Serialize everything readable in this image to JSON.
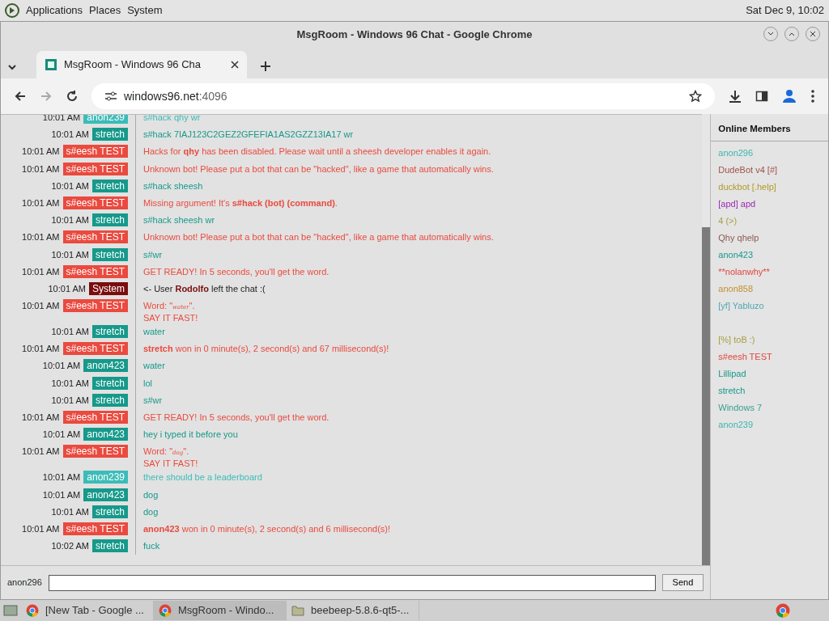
{
  "desktop_bar": {
    "menus": [
      "Applications",
      "Places",
      "System"
    ],
    "clock": "Sat Dec 9, 10:02"
  },
  "window": {
    "title": "MsgRoom - Windows 96 Chat - Google Chrome"
  },
  "tabs": [
    {
      "label": "MsgRoom - Windows 96 Cha",
      "selected": true
    }
  ],
  "address_bar": {
    "host": "windows96.net",
    "port": ":4096"
  },
  "messages": [
    {
      "time": "10:01 AM",
      "user": "anon239",
      "color": "#3bbcb8",
      "kind": "user",
      "lines": [
        "s#hack qhy wr"
      ]
    },
    {
      "time": "10:01 AM",
      "user": "stretch",
      "color": "#16998a",
      "kind": "user",
      "lines": [
        "s#hack 7IAJ123C2GEZ2GFEFIA1AS2GZZ13IA17 wr"
      ]
    },
    {
      "time": "10:01 AM",
      "user": "s#eesh TEST",
      "color": "#ea4a3f",
      "kind": "user",
      "lines": [
        "Hacks for **qhy** has been disabled. Please wait until a sheesh developer enables it again."
      ]
    },
    {
      "time": "10:01 AM",
      "user": "s#eesh TEST",
      "color": "#ea4a3f",
      "kind": "user",
      "lines": [
        "Unknown bot! Please put a bot that can be \"hacked\", like a game that automatically wins."
      ]
    },
    {
      "time": "10:01 AM",
      "user": "stretch",
      "color": "#16998a",
      "kind": "user",
      "lines": [
        "s#hack sheesh"
      ]
    },
    {
      "time": "10:01 AM",
      "user": "s#eesh TEST",
      "color": "#ea4a3f",
      "kind": "user",
      "lines": [
        "Missing argument! It's **s#hack (bot) (command)**."
      ]
    },
    {
      "time": "10:01 AM",
      "user": "stretch",
      "color": "#16998a",
      "kind": "user",
      "lines": [
        "s#hack sheesh wr"
      ]
    },
    {
      "time": "10:01 AM",
      "user": "s#eesh TEST",
      "color": "#ea4a3f",
      "kind": "user",
      "lines": [
        "Unknown bot! Please put a bot that can be \"hacked\", like a game that automatically wins."
      ]
    },
    {
      "time": "10:01 AM",
      "user": "stretch",
      "color": "#16998a",
      "kind": "user",
      "lines": [
        "s#wr"
      ]
    },
    {
      "time": "10:01 AM",
      "user": "s#eesh TEST",
      "color": "#ea4a3f",
      "kind": "user",
      "lines": [
        "GET READY! In 5 seconds, you'll get the word."
      ]
    },
    {
      "time": "10:01 AM",
      "user": "System",
      "color": "#7a0d0d",
      "kind": "system",
      "lines": [
        "<- User **Rodolfo** left the chat :("
      ]
    },
    {
      "time": "10:01 AM",
      "user": "s#eesh TEST",
      "color": "#ea4a3f",
      "kind": "user",
      "word": [
        "Word: \"",
        "water",
        "\"."
      ],
      "lines": [
        "SAY IT FAST!"
      ]
    },
    {
      "time": "10:01 AM",
      "user": "stretch",
      "color": "#16998a",
      "kind": "user",
      "lines": [
        "water"
      ]
    },
    {
      "time": "10:01 AM",
      "user": "s#eesh TEST",
      "color": "#ea4a3f",
      "kind": "user",
      "lines": [
        "**stretch** won in 0 minute(s), 2 second(s) and 67 millisecond(s)!"
      ]
    },
    {
      "time": "10:01 AM",
      "user": "anon423",
      "color": "#16998a",
      "kind": "user",
      "lines": [
        "water"
      ]
    },
    {
      "time": "10:01 AM",
      "user": "stretch",
      "color": "#16998a",
      "kind": "user",
      "lines": [
        "lol"
      ]
    },
    {
      "time": "10:01 AM",
      "user": "stretch",
      "color": "#16998a",
      "kind": "user",
      "lines": [
        "s#wr"
      ]
    },
    {
      "time": "10:01 AM",
      "user": "s#eesh TEST",
      "color": "#ea4a3f",
      "kind": "user",
      "lines": [
        "GET READY! In 5 seconds, you'll get the word."
      ]
    },
    {
      "time": "10:01 AM",
      "user": "anon423",
      "color": "#16998a",
      "kind": "user",
      "lines": [
        "hey i typed it before you"
      ]
    },
    {
      "time": "10:01 AM",
      "user": "s#eesh TEST",
      "color": "#ea4a3f",
      "kind": "user",
      "word": [
        "Word: \"",
        "dog",
        "\"."
      ],
      "lines": [
        "SAY IT FAST!"
      ]
    },
    {
      "time": "10:01 AM",
      "user": "anon239",
      "color": "#3bbcb8",
      "kind": "user",
      "lines": [
        "there should be a leaderboard"
      ]
    },
    {
      "time": "10:01 AM",
      "user": "anon423",
      "color": "#16998a",
      "kind": "user",
      "lines": [
        "dog"
      ]
    },
    {
      "time": "10:01 AM",
      "user": "stretch",
      "color": "#16998a",
      "kind": "user",
      "lines": [
        "dog"
      ]
    },
    {
      "time": "10:01 AM",
      "user": "s#eesh TEST",
      "color": "#ea4a3f",
      "kind": "user",
      "lines": [
        "**anon423** won in 0 minute(s), 2 second(s) and 6 millisecond(s)!"
      ]
    },
    {
      "time": "10:02 AM",
      "user": "stretch",
      "color": "#16998a",
      "kind": "user",
      "lines": [
        "fuck"
      ]
    }
  ],
  "members_panel": {
    "title": "Online Members",
    "members": [
      {
        "name": "anon296",
        "color": "#3bb5b0"
      },
      {
        "name": "DudeBot v4 [#]",
        "color": "#a0524a"
      },
      {
        "name": "duckbot [.help]",
        "color": "#b09a2a"
      },
      {
        "name": "[apd] apd",
        "color": "#9a2ab0"
      },
      {
        "name": "4 (>)",
        "color": "#a8a040"
      },
      {
        "name": "Qhy   qhelp",
        "color": "#8a5a50"
      },
      {
        "name": "anon423",
        "color": "#16998a"
      },
      {
        "name": "**nolanwhy**",
        "color": "#e0453d"
      },
      {
        "name": "anon858",
        "color": "#c09030"
      },
      {
        "name": "[yf] Yabluzo",
        "color": "#50a8b0"
      },
      {
        "name": "[%] toB :)",
        "color": "#a8a040",
        "gap_before": true
      },
      {
        "name": "s#eesh TEST",
        "color": "#e0453d"
      },
      {
        "name": "Lillipad",
        "color": "#16998a"
      },
      {
        "name": "stretch",
        "color": "#16998a"
      },
      {
        "name": "Windows 7",
        "color": "#3aa090"
      },
      {
        "name": "anon239",
        "color": "#3bb5b0"
      }
    ]
  },
  "composer": {
    "nickname": "anon296",
    "button": "Send"
  },
  "taskbar": [
    {
      "label": "[New Tab - Google ...",
      "selected": false,
      "kind": "browser"
    },
    {
      "label": "MsgRoom - Windo...",
      "selected": true,
      "kind": "browser"
    },
    {
      "label": "beebeep-5.8.6-qt5-...",
      "selected": false,
      "kind": "folder"
    }
  ]
}
